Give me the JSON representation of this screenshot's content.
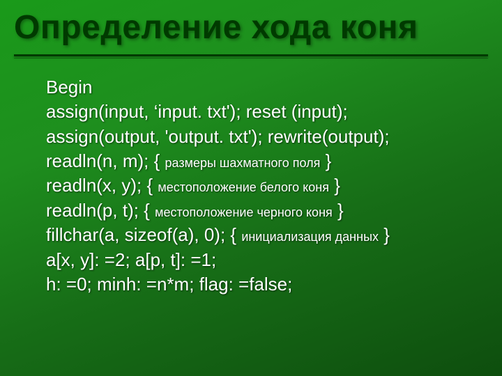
{
  "title": "Определение хода коня",
  "code": {
    "l1_a": "Begin",
    "l2_a": "assign(input, ‘input. txt'); reset (input);",
    "l3_a": "assign(output, 'output. txt'); rewrite(output);",
    "l4_a": "readln(n, m); { ",
    "l4_c": "размеры шахматного поля",
    "l4_b": " }",
    "l5_a": "readln(x, y); { ",
    "l5_c": "местоположение белого коня",
    "l5_b": " }",
    "l6_a": "readln(p, t); { ",
    "l6_c": "местоположение черного коня",
    "l6_b": " }",
    "l7_a": "fillchar(a, sizeof(a), 0); { ",
    "l7_c": "инициализация данных",
    "l7_b": " }",
    "l8_a": "a[x, y]: =2; a[p, t]: =1;",
    "l9_a": "h: =0; minh: =n*m; flag: =false;"
  }
}
